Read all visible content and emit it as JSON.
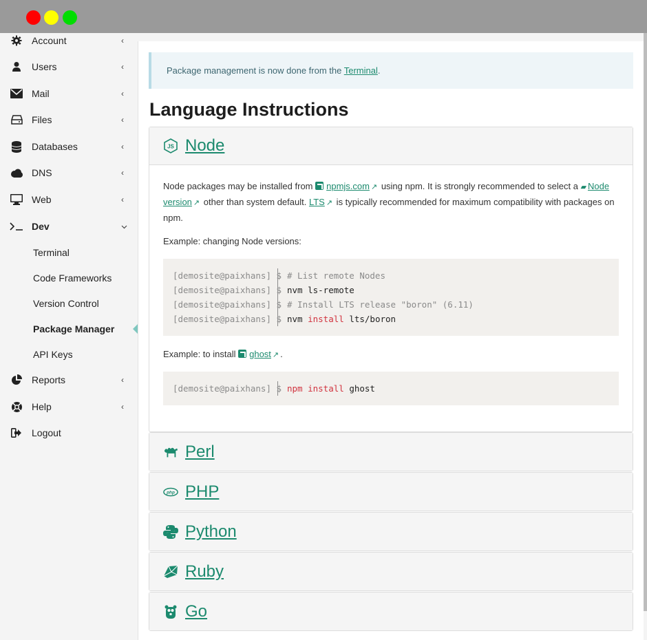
{
  "window": {
    "controls": [
      "close",
      "minimize",
      "maximize"
    ]
  },
  "sidebar": {
    "items": [
      {
        "label": "Account",
        "icon": "gear-icon",
        "chevron": "‹"
      },
      {
        "label": "Users",
        "icon": "user-icon",
        "chevron": "‹"
      },
      {
        "label": "Mail",
        "icon": "envelope-icon",
        "chevron": "‹"
      },
      {
        "label": "Files",
        "icon": "hdd-icon",
        "chevron": "‹"
      },
      {
        "label": "Databases",
        "icon": "database-icon",
        "chevron": "‹"
      },
      {
        "label": "DNS",
        "icon": "cloud-icon",
        "chevron": "‹"
      },
      {
        "label": "Web",
        "icon": "monitor-icon",
        "chevron": "‹"
      },
      {
        "label": "Dev",
        "icon": "terminal-icon",
        "chevron": "⌄"
      }
    ],
    "dev_sub": [
      {
        "label": "Terminal"
      },
      {
        "label": "Code Frameworks"
      },
      {
        "label": "Version Control"
      },
      {
        "label": "Package Manager"
      },
      {
        "label": "API Keys"
      }
    ],
    "items_after": [
      {
        "label": "Reports",
        "icon": "pie-chart-icon",
        "chevron": "‹"
      },
      {
        "label": "Help",
        "icon": "life-ring-icon",
        "chevron": "‹"
      },
      {
        "label": "Logout",
        "icon": "sign-out-icon",
        "chevron": ""
      }
    ]
  },
  "alert": {
    "text_before": "Package management is now done from the ",
    "link": "Terminal",
    "text_after": "."
  },
  "heading": "Language Instructions",
  "node": {
    "title": "Node",
    "p1_a": "Node packages may be installed from ",
    "npm_link": "npmjs.com",
    "p1_b": " using npm. It is strongly recommended to select a ",
    "node_version_link": "Node version",
    "p1_c": " other than system default. ",
    "lts_link": "LTS",
    "p1_d": " is typically recommended for maximum compatibility with packages on npm.",
    "example1_label": "Example: changing Node versions:",
    "code1": {
      "prompts": [
        "[demosite@paixhans] $",
        "[demosite@paixhans] $",
        "[demosite@paixhans] $",
        "[demosite@paixhans] $"
      ],
      "lines": [
        {
          "parts": [
            {
              "t": "# List remote Nodes",
              "c": "comment"
            }
          ]
        },
        {
          "parts": [
            {
              "t": "nvm ls-remote",
              "c": ""
            }
          ]
        },
        {
          "parts": [
            {
              "t": "# Install LTS release \"boron\" (6.11)",
              "c": "comment"
            }
          ]
        },
        {
          "parts": [
            {
              "t": "nvm ",
              "c": ""
            },
            {
              "t": "install",
              "c": "kw"
            },
            {
              "t": " lts/boron",
              "c": ""
            }
          ]
        }
      ]
    },
    "example2_label_a": "Example: to install ",
    "ghost_link": "ghost",
    "example2_label_b": ".",
    "code2": {
      "prompt": "[demosite@paixhans] $",
      "parts": [
        {
          "t": "npm ",
          "c": "kw"
        },
        {
          "t": "install",
          "c": "kw"
        },
        {
          "t": " ghost",
          "c": ""
        }
      ]
    }
  },
  "languages": [
    {
      "title": "Perl",
      "icon": "camel-icon"
    },
    {
      "title": "PHP",
      "icon": "php-icon"
    },
    {
      "title": "Python",
      "icon": "python-icon"
    },
    {
      "title": "Ruby",
      "icon": "gem-icon"
    },
    {
      "title": "Go",
      "icon": "gopher-icon"
    }
  ],
  "colors": {
    "accent": "#1c8a6e",
    "alert_bg": "#eef5f8",
    "code_bg": "#f2f0ed",
    "keyword": "#d1333f"
  }
}
